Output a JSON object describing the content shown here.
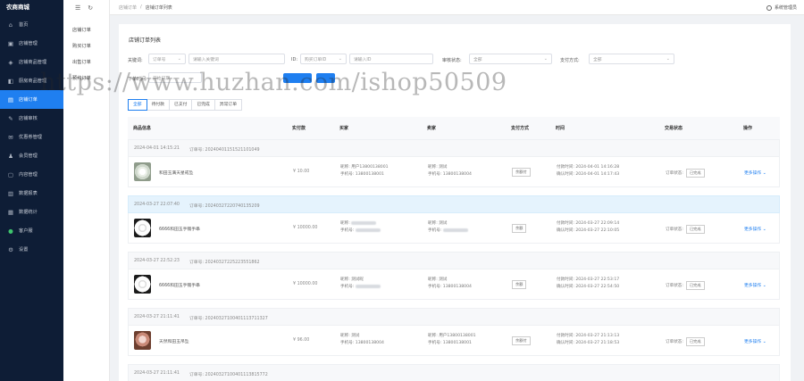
{
  "app": {
    "brand": "农商商城"
  },
  "sidebar": {
    "items": [
      {
        "label": "首页",
        "icon": "home-icon"
      },
      {
        "label": "店铺管理",
        "icon": "store-icon"
      },
      {
        "label": "店铺商品管理",
        "icon": "product-icon"
      },
      {
        "label": "厨房商品管理",
        "icon": "kitchen-icon"
      },
      {
        "label": "店铺订单",
        "icon": "order-icon",
        "active": true
      },
      {
        "label": "店铺审核",
        "icon": "audit-icon"
      },
      {
        "label": "优惠券管理",
        "icon": "coupon-icon"
      },
      {
        "label": "会员管理",
        "icon": "member-icon"
      },
      {
        "label": "内容管理",
        "icon": "content-icon"
      },
      {
        "label": "数据报表",
        "icon": "report-icon"
      },
      {
        "label": "数据统计",
        "icon": "stats-icon"
      },
      {
        "label": "客户服",
        "icon": "service-icon"
      },
      {
        "label": "设置",
        "icon": "settings-icon"
      }
    ]
  },
  "subnav": {
    "items": [
      "店铺订单",
      "购买订单",
      "出售订单",
      "预约订单"
    ]
  },
  "topbar": {
    "breadcrumb": [
      "店铺订单",
      "店铺订单列表"
    ],
    "user": "系统管理员"
  },
  "page": {
    "title": "店铺订单列表"
  },
  "filters": {
    "keyword_label": "关键词:",
    "keyword_type": "订单号",
    "keyword_placeholder": "请输入关键词",
    "id_label": "ID:",
    "id_type": "购买订单ID",
    "id_placeholder": "请输入ID",
    "status_label": "审核状态:",
    "status_value": "全部",
    "pay_label": "支付方式:",
    "pay_value": "全部",
    "time_label": "下单时间:",
    "time_placeholder": "开始日期"
  },
  "tabs": [
    "全部",
    "待付款",
    "已支付",
    "已完成",
    "异常订单"
  ],
  "columns": [
    "商品信息",
    "实付款",
    "买家",
    "卖家",
    "支付方式",
    "时间",
    "交易状态",
    "操作"
  ],
  "orders": [
    {
      "date": "2024-04-01 14:15:21",
      "order_no_label": "订单号:",
      "order_no": "20240401151521101049",
      "product": "和田玉满天星戒坠",
      "price": "¥ 10.00",
      "buyer_name": "昵称: 用户13800138001",
      "buyer_phone": "手机号: 13800138001",
      "seller_name": "昵称: 测试",
      "seller_phone": "手机号: 13800138004",
      "pay": "余额付",
      "paid_time": "付款时间: 2024-04-01 14:16:28",
      "confirm_time": "确认时间: 2024-04-01 14:17:43",
      "status_label": "订单状态:",
      "status": "已完成",
      "action": "更多操作",
      "highlight": false
    },
    {
      "date": "2024-03-27 22:07:40",
      "order_no_label": "订单号:",
      "order_no": "20240327220740135209",
      "product": "6666和田玉手镯手串",
      "price": "¥ 10000.00",
      "buyer_name": "昵称: ",
      "buyer_phone": "手机号: ",
      "seller_name": "昵称: 测试",
      "seller_phone": "手机号: ",
      "pay": "余额",
      "paid_time": "付款时间: 2024-03-27 22:09:14",
      "confirm_time": "确认时间: 2024-03-27 22:10:05",
      "status_label": "订单状态:",
      "status": "已完成",
      "action": "更多操作",
      "highlight": true
    },
    {
      "date": "2024-03-27 22:52:23",
      "order_no_label": "订单号:",
      "order_no": "20240327225223551862",
      "product": "6666和田玉手镯手串",
      "price": "¥ 10000.00",
      "buyer_name": "昵称: 测试昵",
      "buyer_phone": "手机号: ",
      "seller_name": "昵称: 测试",
      "seller_phone": "手机号: 13800138004",
      "pay": "余额",
      "paid_time": "付款时间: 2024-03-27 22:53:17",
      "confirm_time": "确认时间: 2024-03-27 22:54:50",
      "status_label": "订单状态:",
      "status": "已完成",
      "action": "更多操作",
      "highlight": false
    },
    {
      "date": "2024-03-27 21:11:41",
      "order_no_label": "订单号:",
      "order_no": "20240327100401113711327",
      "product": "天然和田玉吊坠",
      "price": "¥ 96.00",
      "buyer_name": "昵称: 测试",
      "buyer_phone": "手机号: 13800138004",
      "seller_name": "昵称: 用户13800138001",
      "seller_phone": "手机号: 13800138001",
      "pay": "余额付",
      "paid_time": "付款时间: 2024-03-27 21:13:13",
      "confirm_time": "确认时间: 2024-03-27 21:18:53",
      "status_label": "订单状态:",
      "status": "已完成",
      "action": "更多操作",
      "highlight": false
    },
    {
      "date": "2024-03-27 21:11:41",
      "order_no_label": "订单号:",
      "order_no": "20240327100401113815772",
      "highlight": false
    }
  ],
  "watermark": "https://www.huzhan.com/ishop50509",
  "colors": {
    "accent": "#1f7ff0",
    "sidebar": "#0e1d36"
  }
}
